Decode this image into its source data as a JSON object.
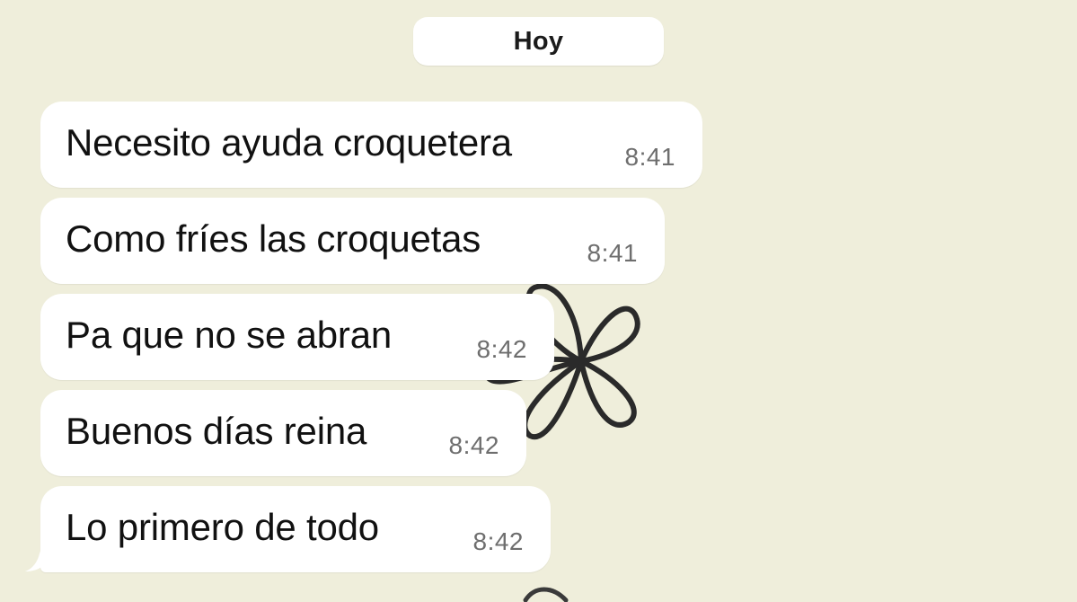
{
  "chat": {
    "date_label": "Hoy",
    "messages": [
      {
        "text": "Necesito ayuda croquetera",
        "time": "8:41"
      },
      {
        "text": "Como fríes las croquetas",
        "time": "8:41"
      },
      {
        "text": "Pa que no se abran",
        "time": "8:42"
      },
      {
        "text": "Buenos días reina",
        "time": "8:42"
      },
      {
        "text": "Lo primero de todo",
        "time": "8:42"
      }
    ]
  },
  "colors": {
    "background": "#efeedb",
    "bubble": "#ffffff",
    "text": "#111111",
    "timestamp": "#6e6e6e"
  },
  "icons": {
    "wallpaper": "flower-doodle-icon"
  }
}
